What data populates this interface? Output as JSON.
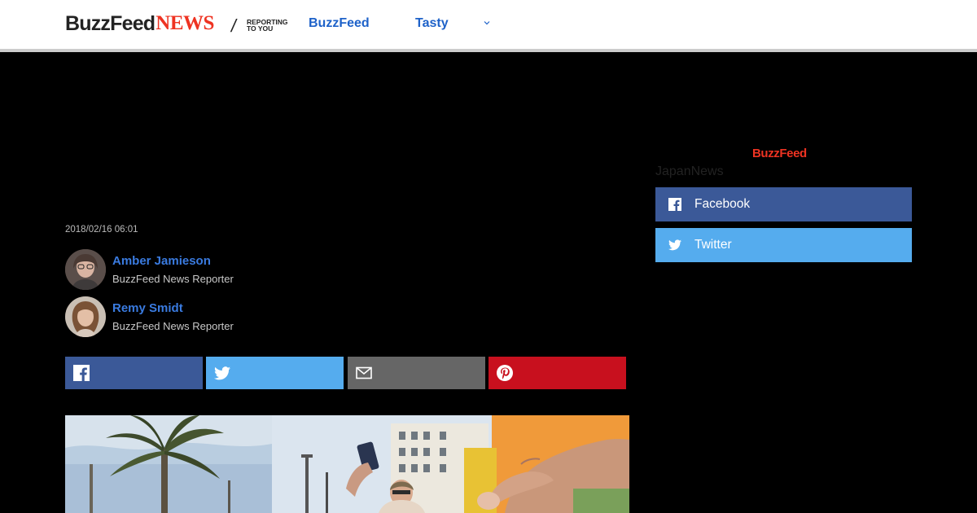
{
  "header": {
    "logo_buzzfeed": "BuzzFeed",
    "logo_news": "NEWS",
    "logo_tagline": "REPORTING\nTO YOU",
    "nav": [
      {
        "label": "BuzzFeed"
      },
      {
        "label": "Tasty"
      }
    ]
  },
  "sidebar": {
    "brand": "BuzzFeed",
    "section_label": "JapanNews",
    "follow": [
      {
        "label": "Facebook",
        "icon": "facebook-icon",
        "color": "#3b5998"
      },
      {
        "label": "Twitter",
        "icon": "twitter-icon",
        "color": "#55acee"
      }
    ]
  },
  "article": {
    "timestamp": "2018/02/16 06:01",
    "authors": [
      {
        "name": "Amber Jamieson",
        "role": "BuzzFeed News Reporter"
      },
      {
        "name": "Remy Smidt",
        "role": "BuzzFeed News Reporter"
      }
    ],
    "share": [
      {
        "icon": "facebook-icon",
        "color": "#3b5998"
      },
      {
        "icon": "twitter-icon",
        "color": "#55acee"
      },
      {
        "icon": "mail-icon",
        "color": "#666666"
      },
      {
        "icon": "pinterest-icon",
        "color": "#c8101e"
      }
    ]
  },
  "colors": {
    "link_blue": "#1e62c9",
    "news_red": "#ee3322",
    "page_bg": "#000000"
  }
}
